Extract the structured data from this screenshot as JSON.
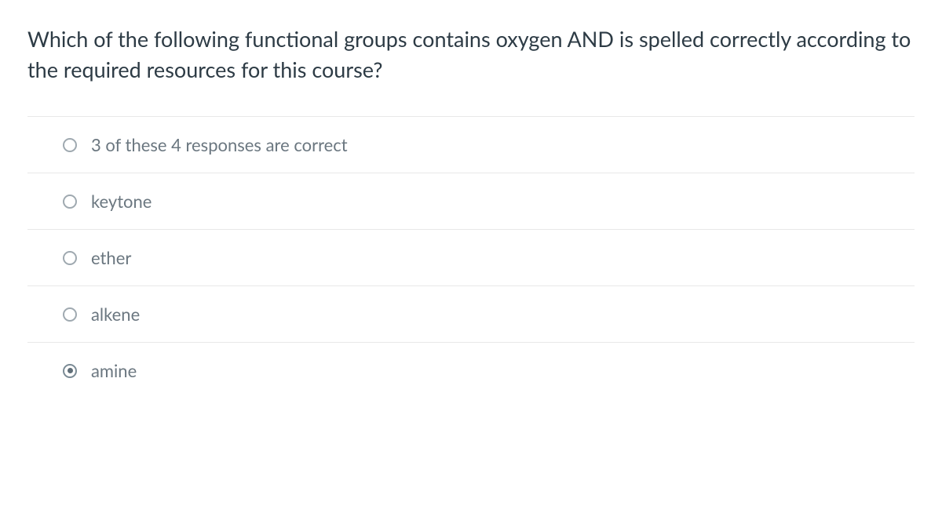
{
  "question": {
    "text": "Which of the following functional groups contains oxygen AND is spelled correctly according to the required resources for this course?"
  },
  "answers": [
    {
      "label": "3 of these 4 responses are correct",
      "selected": false
    },
    {
      "label": "keytone",
      "selected": false
    },
    {
      "label": "ether",
      "selected": false
    },
    {
      "label": "alkene",
      "selected": false
    },
    {
      "label": "amine",
      "selected": true
    }
  ]
}
